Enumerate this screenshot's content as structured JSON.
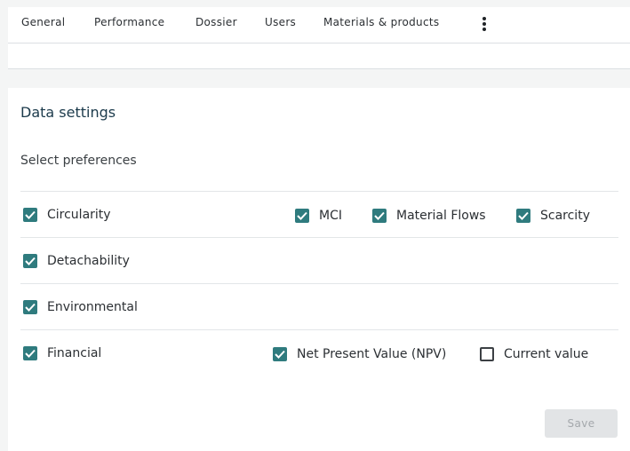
{
  "tabs": [
    "General",
    "Performance",
    "Dossier",
    "Users",
    "Materials & products"
  ],
  "more_icon": "vertical-ellipsis-icon",
  "settings": {
    "title": "Data settings",
    "subtitle": "Select preferences",
    "rows": [
      {
        "category": {
          "label": "Circularity",
          "checked": true
        },
        "options": [
          {
            "label": "MCI",
            "checked": true
          },
          {
            "label": "Material Flows",
            "checked": true
          },
          {
            "label": "Scarcity",
            "checked": true
          }
        ]
      },
      {
        "category": {
          "label": "Detachability",
          "checked": true
        },
        "options": []
      },
      {
        "category": {
          "label": "Environmental",
          "checked": true
        },
        "options": []
      },
      {
        "category": {
          "label": "Financial",
          "checked": true
        },
        "options": [
          {
            "label": "Net Present Value (NPV)",
            "checked": true
          },
          {
            "label": "Current value",
            "checked": false
          }
        ]
      }
    ],
    "save_label": "Save"
  },
  "colors": {
    "accent": "#2f7b7e",
    "disabled_button_bg": "#e2e4e6",
    "disabled_button_text": "#a4a8ac"
  }
}
